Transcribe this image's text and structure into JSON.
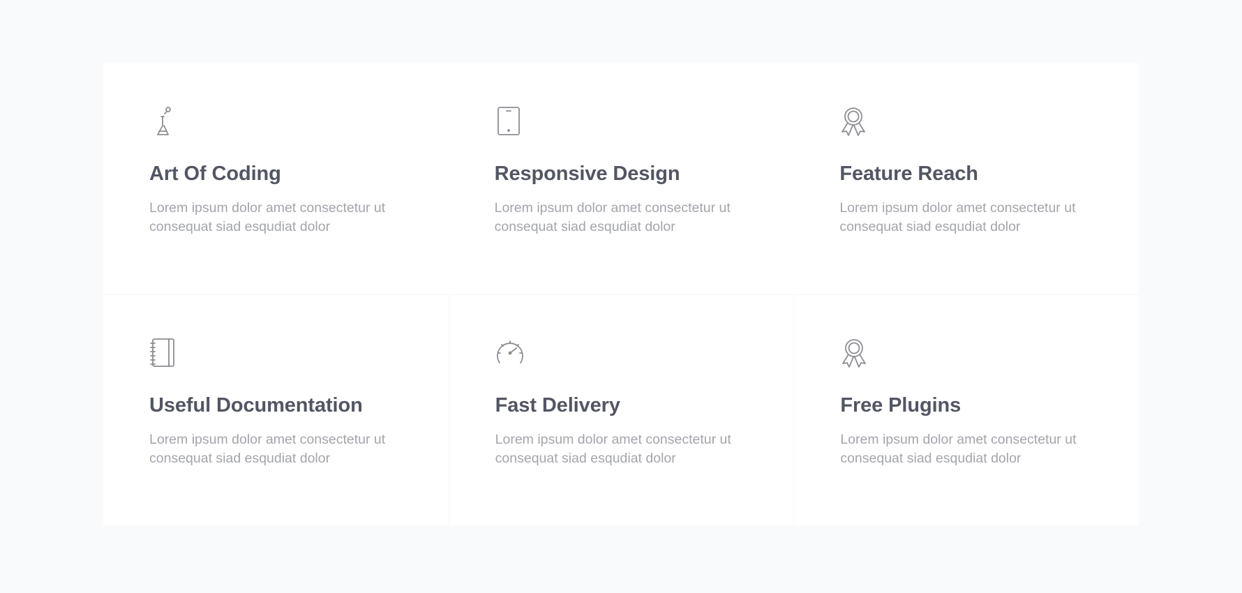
{
  "features": [
    {
      "icon": "flask-icon",
      "title": "Art Of Coding",
      "description": "Lorem ipsum dolor amet consectetur ut consequat siad esqudiat dolor"
    },
    {
      "icon": "tablet-icon",
      "title": "Responsive Design",
      "description": "Lorem ipsum dolor amet consectetur ut consequat siad esqudiat dolor"
    },
    {
      "icon": "award-icon",
      "title": "Feature Reach",
      "description": "Lorem ipsum dolor amet consectetur ut consequat siad esqudiat dolor"
    },
    {
      "icon": "notebook-icon",
      "title": "Useful Documentation",
      "description": "Lorem ipsum dolor amet consectetur ut consequat siad esqudiat dolor"
    },
    {
      "icon": "speedometer-icon",
      "title": "Fast Delivery",
      "description": "Lorem ipsum dolor amet consectetur ut consequat siad esqudiat dolor"
    },
    {
      "icon": "award-icon",
      "title": "Free Plugins",
      "description": "Lorem ipsum dolor amet consectetur ut consequat siad esqudiat dolor"
    }
  ],
  "colors": {
    "page_background": "#f9fafb",
    "panel_background": "#ffffff",
    "title": "#525663",
    "description": "#a3a5ab",
    "icon": "#8b8d93"
  }
}
